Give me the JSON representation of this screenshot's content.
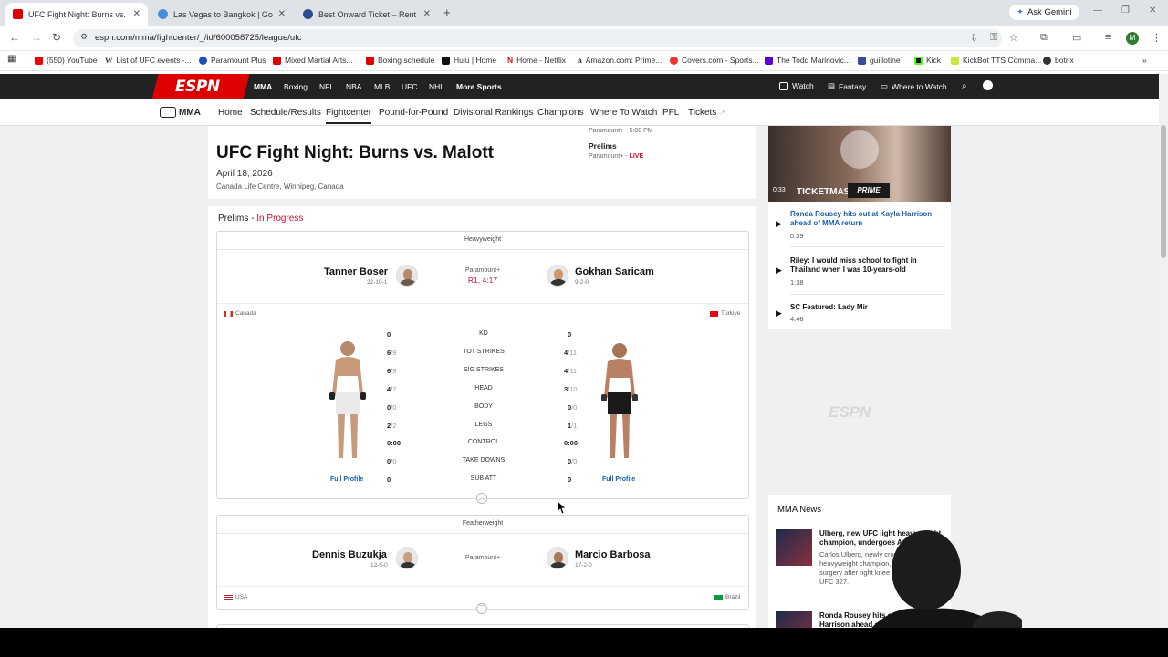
{
  "browser": {
    "tabs": [
      {
        "title": "UFC Fight Night: Burns vs. Malo",
        "active": true
      },
      {
        "title": "Las Vegas to Bangkok | Google",
        "active": false
      },
      {
        "title": "Best Onward Ticket – Rent A Pl",
        "active": false
      }
    ],
    "gemini_label": "Ask Gemini",
    "url": "espn.com/mma/fightcenter/_/id/600058725/league/ufc",
    "avatar_letter": "M",
    "bookmarks": [
      "(550) YouTube",
      "List of UFC events -...",
      "Paramount Plus",
      "Mixed Martial Arts...",
      "Boxing schedule",
      "Hulu | Home",
      "Home - Netflix",
      "Amazon.com: Prime...",
      "Covers.com - Sports...",
      "The Todd Marinovic...",
      "guillotine",
      "Kick",
      "KickBot TTS Comma...",
      "botrix"
    ]
  },
  "espn": {
    "logo": "ESPN",
    "top_nav": [
      "MMA",
      "Boxing",
      "NFL",
      "NBA",
      "MLB",
      "UFC",
      "NHL",
      "More Sports"
    ],
    "top_right": [
      "Watch",
      "Fantasy",
      "Where to Watch"
    ],
    "sub_brand": "MMA",
    "sub_nav": [
      "Home",
      "Schedule/Results",
      "Fightcenter",
      "Pound-for-Pound",
      "Divisional Rankings",
      "Champions",
      "Where To Watch",
      "PFL",
      "Tickets"
    ]
  },
  "event": {
    "title": "UFC Fight Night: Burns vs. Malott",
    "date": "April 18, 2026",
    "venue": "Canada Life Centre, Winnipeg, Canada",
    "broadcast_main": "Paramount+ - 5:00 PM",
    "prelims_label": "Prelims",
    "prelims_broadcast": "Paramount+ - ",
    "prelims_live": "LIVE"
  },
  "section": {
    "label": "Prelims - ",
    "status": "In Progress"
  },
  "fight1": {
    "weight_class": "Heavyweight",
    "broadcast": "Paramount+",
    "result": "R1, 4:17",
    "left": {
      "name": "Tanner Boser",
      "record": "22-10-1",
      "country": "Canada",
      "profile": "Full Profile"
    },
    "right": {
      "name": "Gokhan Saricam",
      "record": "9-2-0",
      "country": "Türkiye",
      "profile": "Full Profile"
    },
    "stats": [
      {
        "label": "KD",
        "left": "0",
        "left_sub": "",
        "right": "0",
        "right_sub": ""
      },
      {
        "label": "TOT STRIKES",
        "left": "6",
        "left_sub": "/9",
        "right": "4",
        "right_sub": "/11"
      },
      {
        "label": "SIG STRIKES",
        "left": "6",
        "left_sub": "/9",
        "right": "4",
        "right_sub": "/11"
      },
      {
        "label": "HEAD",
        "left": "4",
        "left_sub": "/7",
        "right": "3",
        "right_sub": "/10"
      },
      {
        "label": "BODY",
        "left": "0",
        "left_sub": "/0",
        "right": "0",
        "right_sub": "/0"
      },
      {
        "label": "LEGS",
        "left": "2",
        "left_sub": "/2",
        "right": "1",
        "right_sub": "/1"
      },
      {
        "label": "CONTROL",
        "left": "0:00",
        "left_sub": "",
        "right": "0:00",
        "right_sub": ""
      },
      {
        "label": "TAKE DOWNS",
        "left": "0",
        "left_sub": "/0",
        "right": "0",
        "right_sub": "/0"
      },
      {
        "label": "SUB ATT",
        "left": "0",
        "left_sub": "",
        "right": "0",
        "right_sub": ""
      }
    ]
  },
  "fight2": {
    "weight_class": "Featherweight",
    "broadcast": "Paramount+",
    "left": {
      "name": "Dennis Buzukja",
      "record": "12-5-0",
      "country": "USA"
    },
    "right": {
      "name": "Marcio Barbosa",
      "record": "17-2-0",
      "country": "Brazil"
    }
  },
  "video": {
    "thumb_time": "0:33",
    "thumb_text": "TICKETMAS",
    "prime_badge": "PRIME",
    "items": [
      {
        "title": "Ronda Rousey hits out at Kayla Harrison ahead of MMA return",
        "duration": "0:39",
        "highlight": true
      },
      {
        "title": "Riley: I would miss school to fight in Thailand when I was 10-years-old",
        "duration": "1:38",
        "highlight": false
      },
      {
        "title": "SC Featured: Lady Mir",
        "duration": "4:46",
        "highlight": false
      }
    ]
  },
  "ad_logo": "ESPN",
  "news": {
    "heading": "MMA News",
    "items": [
      {
        "title": "Ulberg, new UFC light heavyweight champion, undergoes ACL ...",
        "body": "Carlos Ulberg, newly crowned light heavyweight champion, has had ACL surgery after right knee in Saturday's ... UFC 327."
      },
      {
        "title": "Ronda Rousey hits out at ... Harrison ahead of MMA ...",
        "body": ""
      }
    ]
  },
  "colors": {
    "espn_red": "#d00000",
    "live_red": "#c8102e",
    "link_blue": "#1a5ea8"
  }
}
